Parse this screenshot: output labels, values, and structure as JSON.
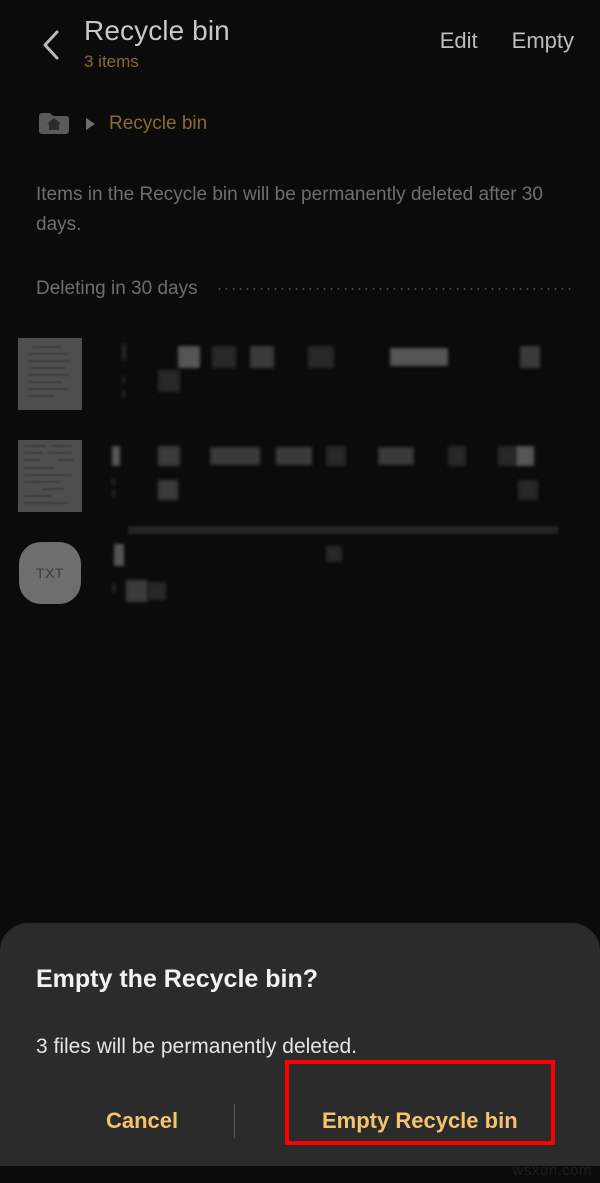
{
  "header": {
    "back_icon": "chevron-left-icon",
    "title": "Recycle bin",
    "subtitle": "3 items",
    "edit_label": "Edit",
    "empty_label": "Empty"
  },
  "breadcrumb": {
    "home_icon": "home-folder-icon",
    "separator_icon": "triangle-right-icon",
    "current": "Recycle bin"
  },
  "notice": "Items in the Recycle bin will be permanently deleted after 30 days.",
  "section": {
    "label": "Deleting in 30 days"
  },
  "files": [
    {
      "thumbnail": "document-thumbnail",
      "name_redacted": true
    },
    {
      "thumbnail": "document-thumbnail",
      "name_redacted": true
    },
    {
      "thumbnail": "txt-file-icon",
      "icon_label": "TXT",
      "name_redacted": true
    }
  ],
  "dialog": {
    "title": "Empty the Recycle bin?",
    "message": "3 files will be permanently deleted.",
    "cancel_label": "Cancel",
    "confirm_label": "Empty Recycle bin"
  },
  "annotation": {
    "target": "Empty Recycle bin",
    "color": "#ff0000"
  },
  "watermark": "wsxdn.com",
  "colors": {
    "background": "#0b0b0b",
    "dialog_bg": "#2b2b2b",
    "accent_amber": "#f3c46b",
    "accent_amber_dim": "#8a6a35",
    "text_primary": "#f2f2f2",
    "text_secondary": "#6e6e6e",
    "highlight_red": "#ff0000"
  }
}
